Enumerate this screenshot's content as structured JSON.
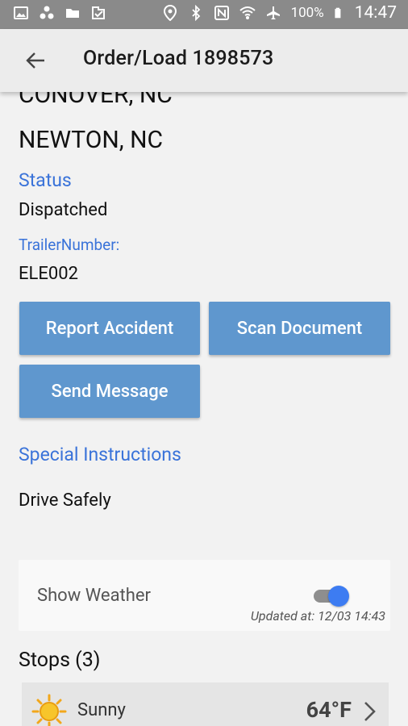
{
  "statusbar": {
    "battery": "100%",
    "time": "14:47"
  },
  "appbar": {
    "title": "Order/Load 1898573"
  },
  "order": {
    "origin": "CONOVER, NC",
    "destination": "NEWTON, NC",
    "status_label": "Status",
    "status_value": "Dispatched",
    "trailer_label": "TrailerNumber:",
    "trailer_value": "ELE002"
  },
  "actions": {
    "report_accident": "Report Accident",
    "scan_document": "Scan Document",
    "send_message": "Send Message"
  },
  "instructions": {
    "label": "Special Instructions",
    "value": "Drive Safely"
  },
  "weather": {
    "label": "Show Weather",
    "enabled": true,
    "updated": "Updated at: 12/03 14:43",
    "condition": "Sunny",
    "temperature": "64°F"
  },
  "stops": {
    "title": "Stops (3)"
  },
  "colors": {
    "accent_blue": "#3a73d9",
    "button_blue": "#5f97ce",
    "toggle_on": "#3d7cf2"
  },
  "icons": [
    "gallery-icon",
    "share-icon",
    "folder-icon",
    "task-icon",
    "location-icon",
    "bluetooth-icon",
    "nfc-icon",
    "wifi-icon",
    "airplane-icon",
    "battery-icon",
    "back-arrow-icon",
    "sun-icon",
    "chevron-right-icon"
  ]
}
